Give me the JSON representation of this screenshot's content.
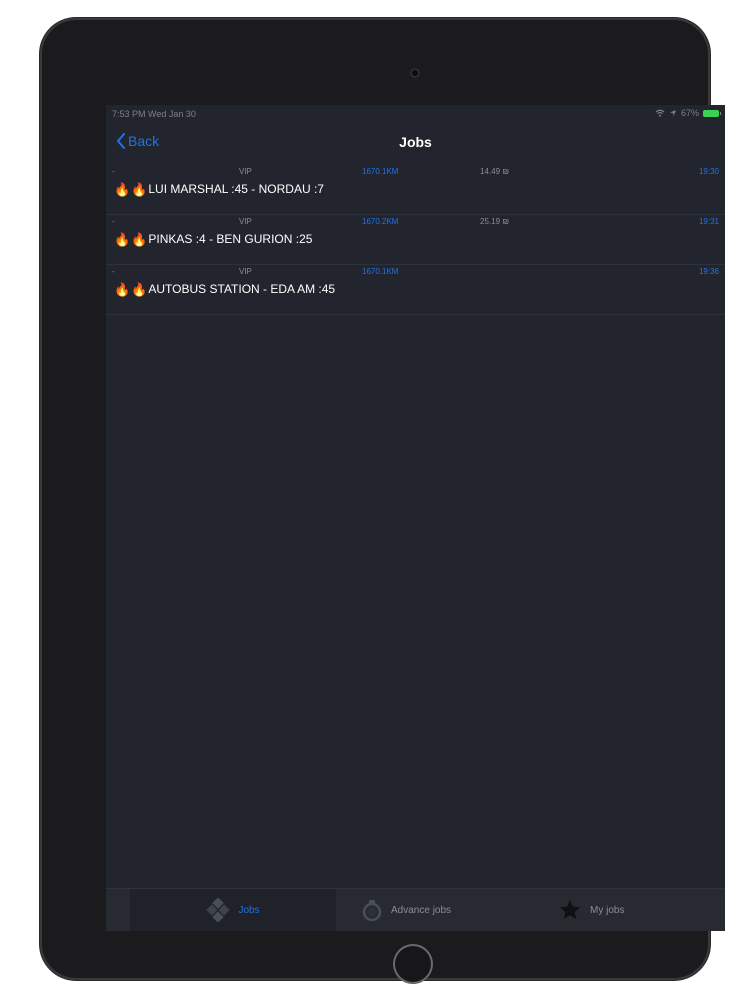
{
  "status": {
    "time": "7:53 PM   Wed Jan 30",
    "battery": "67%"
  },
  "nav": {
    "back": "Back",
    "title": "Jobs"
  },
  "jobs": [
    {
      "dash": "-",
      "vip": "VIP",
      "distance": "1670.1KM",
      "price": "14.49 ₪",
      "time": "19:30",
      "title": "LUI MARSHAL :45 - NORDAU :7"
    },
    {
      "dash": "-",
      "vip": "VIP",
      "distance": "1670.2KM",
      "price": "25.19 ₪",
      "time": "19:31",
      "title": "PINKAS :4 - BEN GURION :25"
    },
    {
      "dash": "-",
      "vip": "VIP",
      "distance": "1670.1KM",
      "price": "",
      "time": "19:36",
      "title": "AUTOBUS STATION - EDA AM :45"
    }
  ],
  "tabs": {
    "jobs": "Jobs",
    "advance": "Advance jobs",
    "my_jobs": "My jobs"
  },
  "icons": {
    "back": "chevron-left-icon",
    "fire": "fire-icon",
    "jobs": "jobs-icon",
    "advance": "advance-jobs-icon",
    "my_jobs": "star-icon"
  },
  "colors": {
    "accent": "#1f74e6",
    "background": "#22252d",
    "battery": "#39d353"
  }
}
